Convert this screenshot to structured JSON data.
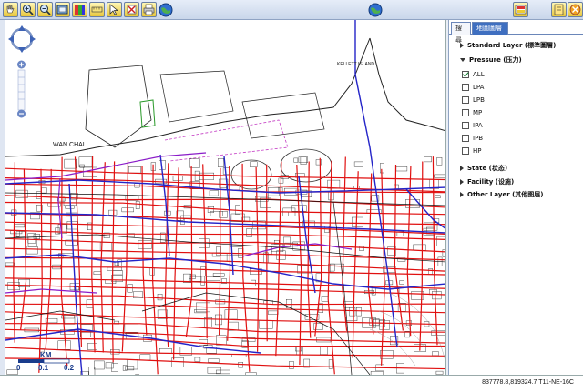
{
  "toolbar": {
    "buttons": [
      {
        "name": "pan-hand-icon"
      },
      {
        "name": "zoom-in-icon"
      },
      {
        "name": "zoom-out-icon"
      },
      {
        "name": "full-extent-icon"
      },
      {
        "name": "layer-color-icon"
      },
      {
        "name": "measure-icon"
      },
      {
        "name": "identify-icon"
      },
      {
        "name": "clear-icon"
      },
      {
        "name": "print-icon"
      },
      {
        "name": "globe-icon"
      }
    ],
    "center_icon": "globe-icon",
    "right_buttons": [
      {
        "name": "export-icon"
      },
      {
        "name": "panel-toggle-icon"
      },
      {
        "name": "help-icon"
      }
    ]
  },
  "map": {
    "labels": {
      "wan_chai": "WAN CHAI",
      "kellett_island": "KELLETT ISLAND"
    }
  },
  "scale": {
    "unit": "KM",
    "ticks": [
      "0",
      "0.1",
      "0.2"
    ]
  },
  "panel": {
    "tabs": [
      "搜尋",
      "地圖圖層"
    ],
    "layers": {
      "standard": "Standard Layer (標準圖層)",
      "pressure": "Pressure (压力)",
      "pressure_items": [
        "ALL",
        "LPA",
        "LPB",
        "MP",
        "IPA",
        "IPB",
        "HP"
      ],
      "checked": [
        "ALL"
      ],
      "state": "State (状态)",
      "facility": "Facility (设施)",
      "other": "Other Layer (其他图层)"
    }
  },
  "status": {
    "coords": "837778.8,819324.7 T11-NE-16C"
  },
  "colors": {
    "pipe_red": "#e01010",
    "pipe_blue": "#2424c8",
    "pipe_purple": "#8a1cc8",
    "tab_active": "#3f6fc0"
  }
}
